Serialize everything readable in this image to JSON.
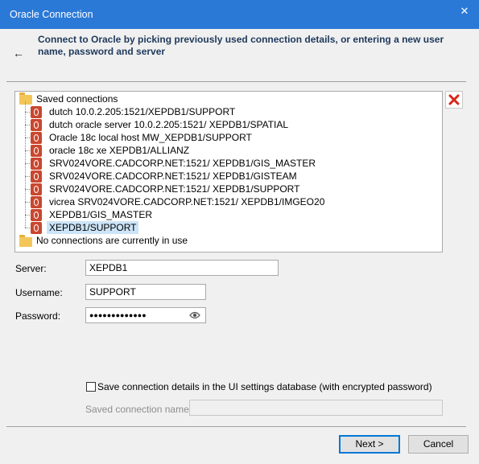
{
  "window": {
    "title": "Oracle Connection",
    "close_glyph": "✕"
  },
  "header": {
    "back_glyph": "←",
    "text": "Connect to Oracle by picking previously used connection details, or entering a new user name, password and server"
  },
  "tree": {
    "saved_label": "Saved connections",
    "connections": [
      "dutch 10.0.2.205:1521/XEPDB1/SUPPORT",
      "dutch oracle server 10.0.2.205:1521/ XEPDB1/SPATIAL",
      "Oracle 18c local host   MW_XEPDB1/SUPPORT",
      "oracle 18c xe      XEPDB1/ALLIANZ",
      "SRV024VORE.CADCORP.NET:1521/ XEPDB1/GIS_MASTER",
      "SRV024VORE.CADCORP.NET:1521/ XEPDB1/GISTEAM",
      "SRV024VORE.CADCORP.NET:1521/ XEPDB1/SUPPORT",
      "vicrea SRV024VORE.CADCORP.NET:1521/ XEPDB1/IMGEO20",
      "XEPDB1/GIS_MASTER",
      "XEPDB1/SUPPORT"
    ],
    "selected_index": 9,
    "inuse_label": "No connections are currently in use"
  },
  "form": {
    "server_label": "Server:",
    "server_value": "XEPDB1",
    "username_label": "Username:",
    "username_value": "SUPPORT",
    "password_label": "Password:",
    "password_value": "●●●●●●●●●●●●●"
  },
  "save": {
    "checkbox_label": "Save connection details in the UI settings database (with encrypted password)",
    "checked": false,
    "name_label": "Saved connection name:",
    "name_value": ""
  },
  "buttons": {
    "next": "Next >",
    "cancel": "Cancel"
  },
  "colors": {
    "titlebar": "#2b79d7",
    "db_icon": "#c9472f",
    "delete_red": "#d9261c",
    "selection": "#cce4f7"
  }
}
